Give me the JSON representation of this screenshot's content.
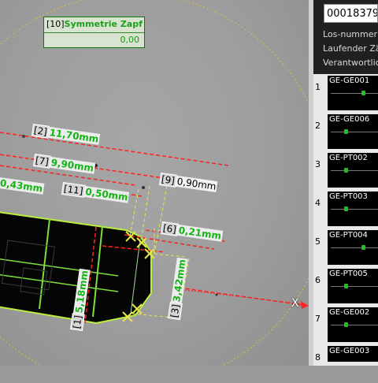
{
  "tolerance_box": {
    "index": "[10]",
    "title": "Symmetrie Zapf",
    "value": "0,00"
  },
  "measurements": [
    {
      "id": "m2",
      "index": "[2]",
      "value": "11,70mm"
    },
    {
      "id": "m7",
      "index": "[7]",
      "value": "9,90mm"
    },
    {
      "id": "m0",
      "index": "",
      "value": "0,43mm"
    },
    {
      "id": "m11",
      "index": "[11]",
      "value": "0,50mm"
    },
    {
      "id": "m9",
      "index": "[9]",
      "value": "0,90mm"
    },
    {
      "id": "m6",
      "index": "[6]",
      "value": "0,21mm"
    },
    {
      "id": "m1",
      "index": "[1]",
      "value": "5,18mm"
    },
    {
      "id": "m3",
      "index": "[3]",
      "value": "3,42mm"
    }
  ],
  "axis_marker": "X",
  "panel": {
    "lot_number": "00018379",
    "labels": [
      "Los-nummer",
      "Laufender Zä",
      "Verantwortlich"
    ]
  },
  "list": [
    {
      "num": "1",
      "name": "GE-GE001",
      "fill": 0.7
    },
    {
      "num": "2",
      "name": "GE-GE006",
      "fill": 0.3
    },
    {
      "num": "3",
      "name": "GE-PT002",
      "fill": 0.3
    },
    {
      "num": "4",
      "name": "GE-PT003",
      "fill": 0.3
    },
    {
      "num": "5",
      "name": "GE-PT004",
      "fill": 0.7
    },
    {
      "num": "6",
      "name": "GE-PT005",
      "fill": 0.3
    },
    {
      "num": "7",
      "name": "GE-GE002",
      "fill": 0.3
    },
    {
      "num": "8",
      "name": "GE-GE003",
      "fill": 0.3
    }
  ],
  "colors": {
    "green": "#13b413",
    "red": "#ff2020",
    "yellow": "#e6e64a",
    "outline": "#b8f040"
  }
}
